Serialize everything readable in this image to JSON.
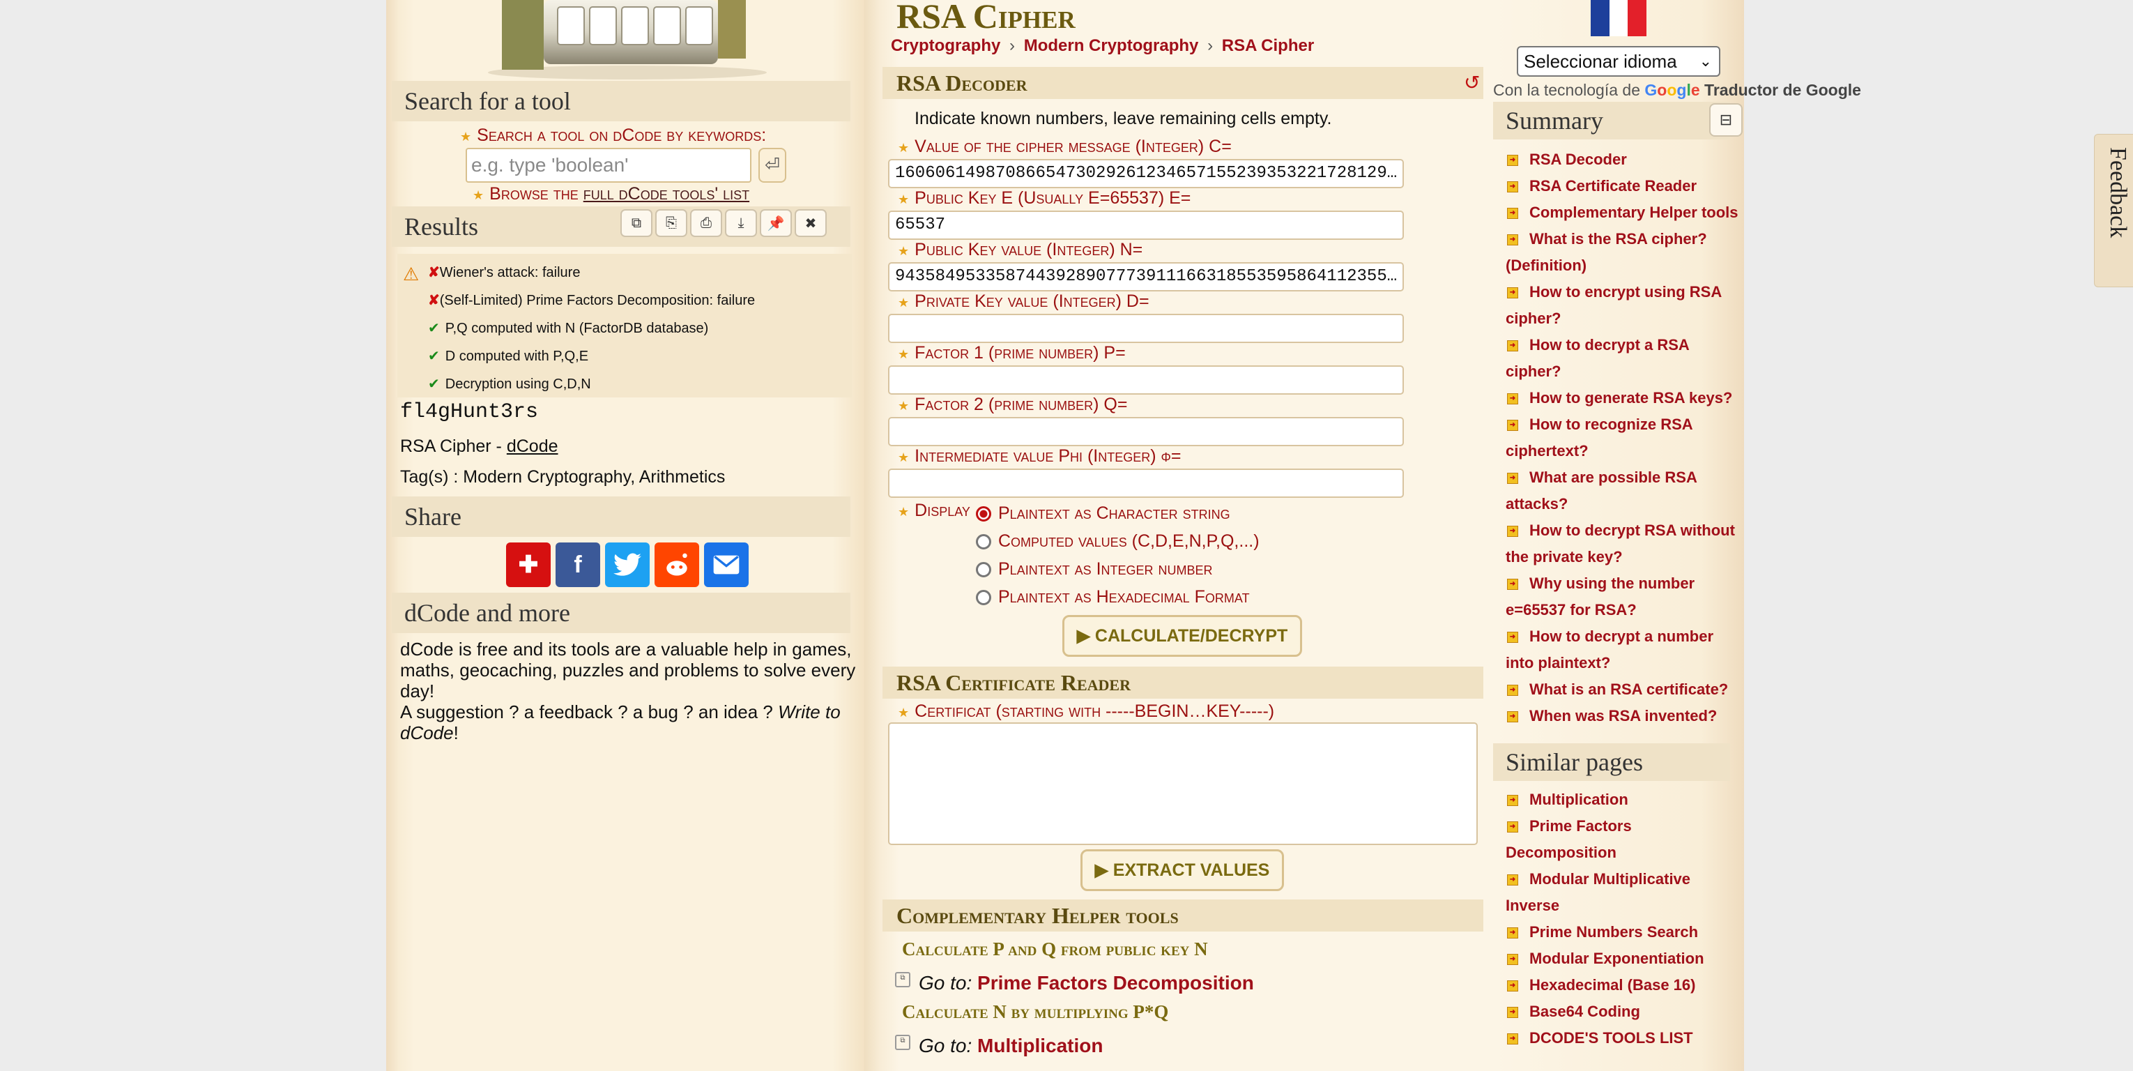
{
  "left": {
    "search_heading": "Search for a tool",
    "search_label": "Search a tool on dCode by keywords:",
    "search_placeholder": "e.g. type 'boolean'",
    "search_go": "⏎",
    "browse_prefix": "Browse the ",
    "browse_link": "full dCode tools' list",
    "results_heading": "Results",
    "results": [
      {
        "status": "fail",
        "text": "Wiener's attack: failure"
      },
      {
        "status": "fail",
        "text": "(Self-Limited) Prime Factors Decomposition: failure"
      },
      {
        "status": "ok",
        "text": "P,Q computed with N (FactorDB database)"
      },
      {
        "status": "ok",
        "text": "D computed with P,Q,E"
      },
      {
        "status": "ok",
        "text": "Decryption using C,D,N"
      }
    ],
    "result_output": "fl4gHunt3rs",
    "result_source_prefix": "RSA Cipher - ",
    "result_source_link": "dCode",
    "result_tags": "Tag(s) : Modern Cryptography, Arithmetics",
    "share_heading": "Share",
    "more_heading": "dCode and more",
    "more_text_1": "dCode is free and its tools are a valuable help in games, maths, geocaching, puzzles and problems to solve every day!",
    "more_text_2": "A suggestion ? a feedback ? a bug ? an idea ? ",
    "more_text_link": "Write to dCode",
    "more_text_end": "!"
  },
  "main": {
    "title": "RSA Cipher",
    "breadcrumb": [
      "Cryptography",
      "Modern Cryptography",
      "RSA Cipher"
    ],
    "decoder_heading": "RSA Decoder",
    "decoder_instructions": "Indicate known numbers, leave remaining cells empty.",
    "fields": {
      "c_label": "Value of the cipher message (Integer) C=",
      "c_value": "1606061498708665473029261234657155239353221728129…",
      "e_label": "Public Key E (Usually E=65537) E=",
      "e_value": "65537",
      "n_label": "Public Key value (Integer) N=",
      "n_value": "9435849533587443928907773911166318553595864112355…",
      "d_label": "Private Key value (Integer) D=",
      "d_value": "",
      "p_label": "Factor 1 (prime number) P=",
      "p_value": "",
      "q_label": "Factor 2 (prime number) Q=",
      "q_value": "",
      "phi_label": "Intermediate value Phi (Integer) φ=",
      "phi_value": ""
    },
    "display_label": "Display",
    "display_options": [
      "Plaintext as Character string",
      "Computed values (C,D,E,N,P,Q,...)",
      "Plaintext as Integer number",
      "Plaintext as Hexadecimal Format"
    ],
    "display_selected": 0,
    "calculate_button": "▶ CALCULATE/DECRYPT",
    "cert_heading": "RSA Certificate Reader",
    "cert_label": "Certificat (starting with -----BEGIN…KEY-----)",
    "extract_button": "▶ EXTRACT VALUES",
    "helper_heading": "Complementary Helper tools",
    "helper_1_title": "Calculate P and Q from public key N",
    "helper_1_goto": "Go to:",
    "helper_1_link": "Prime Factors Decomposition",
    "helper_2_title": "Calculate N by multiplying P*Q",
    "helper_2_goto": "Go to:",
    "helper_2_link": "Multiplication"
  },
  "right": {
    "language_select": "Seleccionar idioma",
    "powered_prefix": "Con la tecnología de",
    "powered_google": "Google",
    "powered_suffix": "Traductor de Google",
    "summary_heading": "Summary",
    "summary_items": [
      "RSA Decoder",
      "RSA Certificate Reader",
      "Complementary Helper tools",
      "What is the RSA cipher? (Definition)",
      "How to encrypt using RSA cipher?",
      "How to decrypt a RSA cipher?",
      "How to generate RSA keys?",
      "How to recognize RSA ciphertext?",
      "What are possible RSA attacks?",
      "How to decrypt RSA without the private key?",
      "Why using the number e=65537 for RSA?",
      "How to decrypt a number into plaintext?",
      "What is an RSA certificate?",
      "When was RSA invented?"
    ],
    "similar_heading": "Similar pages",
    "similar_items": [
      "Multiplication",
      "Prime Factors Decomposition",
      "Modular Multiplicative Inverse",
      "Prime Numbers Search",
      "Modular Exponentiation",
      "Hexadecimal (Base 16)",
      "Base64 Coding",
      "DCODE'S TOOLS LIST"
    ],
    "feedback_tab": "Feedback"
  },
  "colors": {
    "accent_red": "#a0101a",
    "gold_text": "#6b5a10",
    "section_bg": "#f0e2c4"
  }
}
